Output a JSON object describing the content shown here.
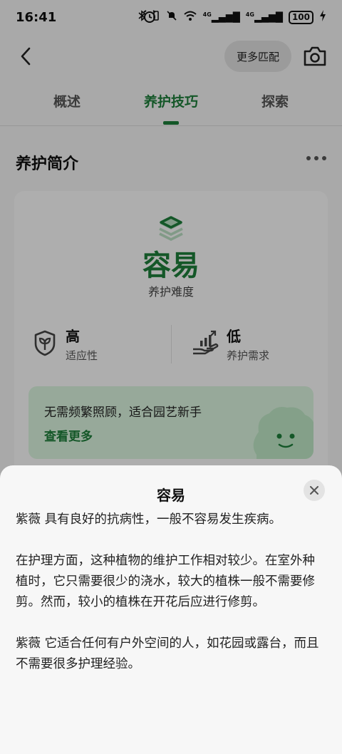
{
  "status_bar": {
    "time": "16:41",
    "signal_1": "4G",
    "signal_2": "4G",
    "battery": "100"
  },
  "header": {
    "more_match_label": "更多匹配"
  },
  "tabs": [
    {
      "label": "概述",
      "active": false
    },
    {
      "label": "养护技巧",
      "active": true
    },
    {
      "label": "探索",
      "active": false
    }
  ],
  "section": {
    "title": "养护简介"
  },
  "card": {
    "difficulty_value": "容易",
    "difficulty_label": "养护难度",
    "stats": [
      {
        "value": "高",
        "label": "适应性",
        "icon": "shield-leaf-icon"
      },
      {
        "value": "低",
        "label": "养护需求",
        "icon": "hand-growth-icon"
      }
    ],
    "tip": {
      "text": "无需频繁照顾，适合园艺新手",
      "link": "查看更多"
    }
  },
  "sheet": {
    "title": "容易",
    "paragraphs": [
      "紫薇 具有良好的抗病性，一般不容易发生疾病。",
      "在护理方面，这种植物的维护工作相对较少。在室外种植时，它只需要很少的浇水，较大的植株一般不需要修剪。然而，较小的植株在开花后应进行修剪。",
      "紫薇 它适合任何有户外空间的人，如花园或露台，而且不需要很多护理经验。"
    ]
  },
  "colors": {
    "accent": "#1e7d3a",
    "tip_background": "#d9f2dd",
    "overlay": "rgba(0,0,0,0.30)"
  }
}
